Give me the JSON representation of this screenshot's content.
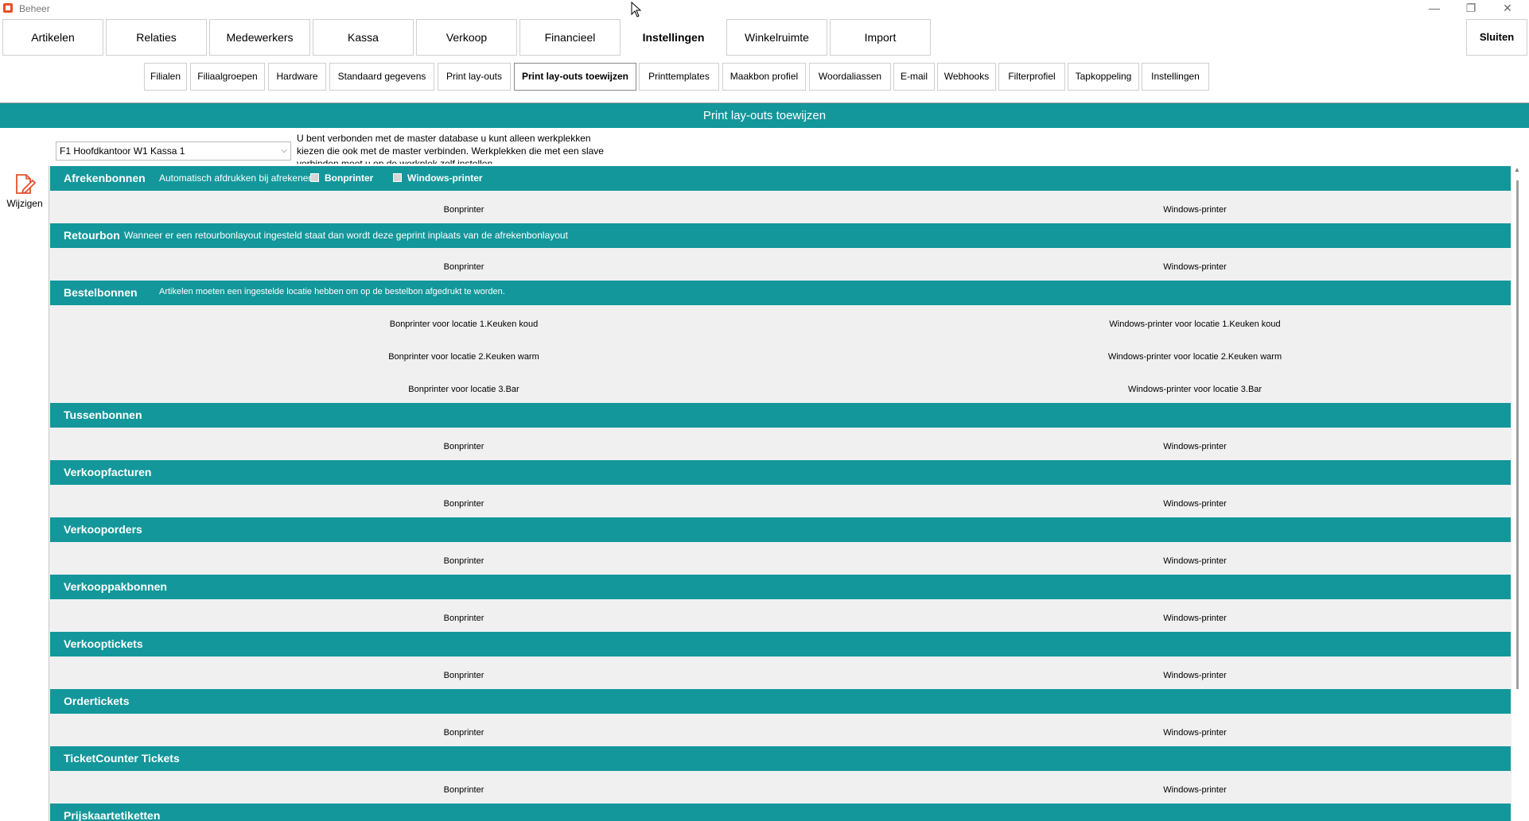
{
  "window": {
    "title": "Beheer",
    "controls": {
      "minimize": "—",
      "maximize": "❐",
      "close": "✕"
    }
  },
  "main_tabs": [
    "Artikelen",
    "Relaties",
    "Medewerkers",
    "Kassa",
    "Verkoop",
    "Financieel",
    "Instellingen",
    "Winkelruimte",
    "Import"
  ],
  "active_main_tab": "Instellingen",
  "close_button": "Sluiten",
  "sub_tabs": [
    "Filialen",
    "Filiaalgroepen",
    "Hardware",
    "Standaard gegevens",
    "Print lay-outs",
    "Print lay-outs toewijzen",
    "Printtemplates",
    "Maakbon profiel",
    "Woordaliassen",
    "E-mail",
    "Webhooks",
    "Filterprofiel",
    "Tapkoppeling",
    "Instellingen"
  ],
  "active_sub_tab": "Print lay-outs toewijzen",
  "page_title": "Print lay-outs toewijzen",
  "workstation_select": {
    "value": "F1 Hoofdkantoor W1 Kassa 1"
  },
  "info_text": "U bent verbonden met de master database u kunt alleen werkplekken kiezen die ook met de master verbinden. Werkplekken die met een slave verbinden moet u op de werkplek zelf instellen",
  "side_button": {
    "label": "Wijzigen",
    "icon": "edit-document-icon"
  },
  "sections": [
    {
      "title": "Afrekenbonnen",
      "note": "Automatisch afdrukken bij afrekenen",
      "checkbox_bonprinter": "Bonprinter",
      "checkbox_windows": "Windows-printer",
      "rows": [
        [
          "Bonprinter",
          "Windows-printer"
        ]
      ]
    },
    {
      "title": "Retourbon",
      "note": "Wanneer er een retourbonlayout ingesteld staat dan wordt deze geprint inplaats van de afrekenbonlayout",
      "rows": [
        [
          "Bonprinter",
          "Windows-printer"
        ]
      ]
    },
    {
      "title": "Bestelbonnen",
      "note": "Artikelen moeten een ingestelde locatie hebben om op de bestelbon afgedrukt te worden.",
      "rows": [
        [
          "Bonprinter voor locatie 1.Keuken koud",
          "Windows-printer voor locatie 1.Keuken koud"
        ],
        [
          "Bonprinter voor locatie 2.Keuken warm",
          "Windows-printer voor locatie 2.Keuken warm"
        ],
        [
          "Bonprinter voor locatie 3.Bar",
          "Windows-printer voor locatie 3.Bar"
        ]
      ]
    },
    {
      "title": "Tussenbonnen",
      "rows": [
        [
          "Bonprinter",
          "Windows-printer"
        ]
      ]
    },
    {
      "title": "Verkoopfacturen",
      "rows": [
        [
          "Bonprinter",
          "Windows-printer"
        ]
      ]
    },
    {
      "title": "Verkooporders",
      "rows": [
        [
          "Bonprinter",
          "Windows-printer"
        ]
      ]
    },
    {
      "title": "Verkooppakbonnen",
      "rows": [
        [
          "Bonprinter",
          "Windows-printer"
        ]
      ]
    },
    {
      "title": "Verkooptickets",
      "rows": [
        [
          "Bonprinter",
          "Windows-printer"
        ]
      ]
    },
    {
      "title": "Ordertickets",
      "rows": [
        [
          "Bonprinter",
          "Windows-printer"
        ]
      ]
    },
    {
      "title": "TicketCounter Tickets",
      "rows": [
        [
          "Bonprinter",
          "Windows-printer"
        ]
      ]
    },
    {
      "title": "Prijskaartetiketten",
      "rows": []
    }
  ],
  "colors": {
    "accent": "#13979b",
    "grid_background": "#f0f0f0",
    "edit_icon": "#e8502b"
  }
}
